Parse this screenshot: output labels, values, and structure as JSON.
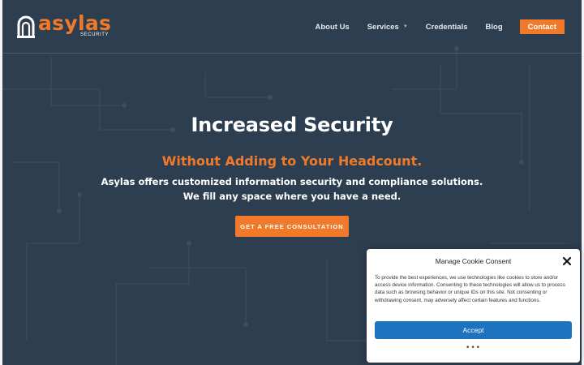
{
  "brand": {
    "wordmark": "asylas",
    "submark": "SECURITY",
    "accent_color": "#f07a2a",
    "background_color": "#2d3e50"
  },
  "nav": {
    "items": [
      {
        "label": "About Us",
        "icon": ""
      },
      {
        "label": "Services",
        "icon": "chevron-down-icon"
      },
      {
        "label": "Credentials",
        "icon": ""
      },
      {
        "label": "Blog",
        "icon": ""
      }
    ],
    "contact_label": "Contact"
  },
  "hero": {
    "title": "Increased Security",
    "subtitle": "Without Adding to Your Headcount.",
    "description_line1": "Asylas offers customized information security and compliance solutions.",
    "description_line2": "We fill any space where you have a need.",
    "cta_label": "GET A FREE CONSULTATION"
  },
  "cookie": {
    "title": "Manage Cookie Consent",
    "body": "To provide the best experiences, we use technologies like cookies to store and/or access device information. Consenting to these technologies will allow us to process data such as browsing behavior or unique IDs on this site. Not consenting or withdrawing consent, may adversely affect certain features and functions.",
    "accept_label": "Accept",
    "more_label": "•••",
    "accept_color": "#1e73be"
  }
}
